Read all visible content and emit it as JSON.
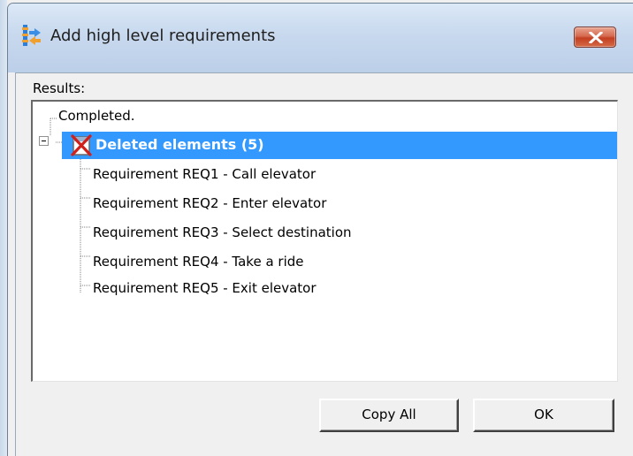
{
  "window": {
    "title": "Add high level requirements"
  },
  "results": {
    "label": "Results:"
  },
  "tree": {
    "root_label": "Completed.",
    "group": {
      "label": "Deleted elements (5)",
      "icon": "deleted-elements-icon",
      "expanded": true,
      "selected": true
    },
    "items": [
      {
        "label": "Requirement REQ1 - Call elevator"
      },
      {
        "label": "Requirement REQ2 - Enter elevator"
      },
      {
        "label": "Requirement REQ3 - Select destination"
      },
      {
        "label": "Requirement REQ4 - Take a ride"
      },
      {
        "label": "Requirement REQ5 - Exit elevator"
      }
    ]
  },
  "buttons": {
    "copy_all": "Copy All",
    "ok": "OK"
  },
  "colors": {
    "selection": "#3399ff",
    "close_button": "#c9452a",
    "titlebar": "#c8d9ee"
  }
}
